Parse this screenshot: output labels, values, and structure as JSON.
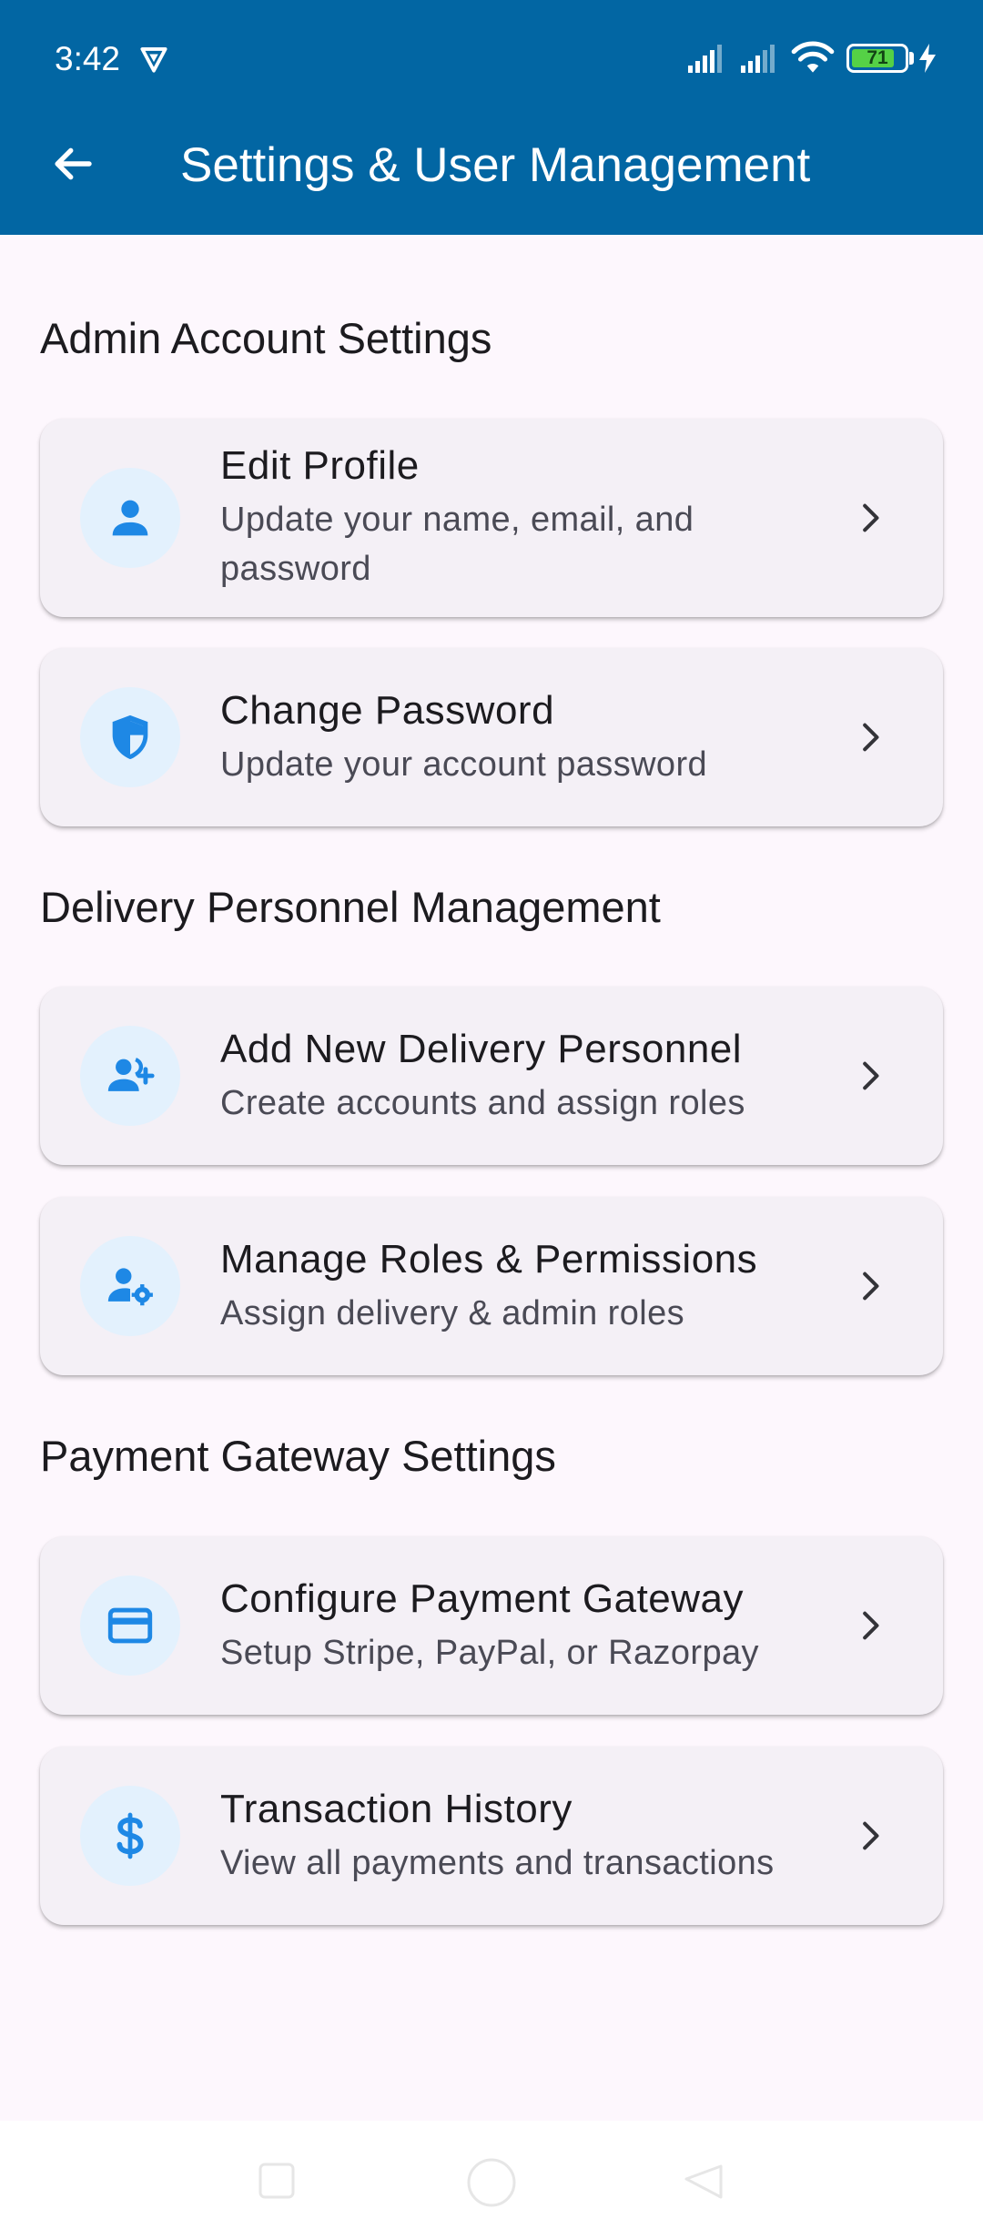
{
  "status_bar": {
    "time": "3:42",
    "battery_level": "71",
    "icons": [
      "vpn-shield-icon",
      "signal-icon",
      "signal-icon",
      "wifi-icon",
      "battery-icon",
      "charging-bolt-icon"
    ]
  },
  "app_bar": {
    "title": "Settings & User Management",
    "back_icon": "arrow-back-icon"
  },
  "sections": [
    {
      "title": "Admin Account Settings",
      "items": [
        {
          "title": "Edit Profile",
          "subtitle": "Update your name, email, and password",
          "icon": "person-icon"
        },
        {
          "title": "Change Password",
          "subtitle": "Update your account password",
          "icon": "shield-icon"
        }
      ]
    },
    {
      "title": "Delivery Personnel Management",
      "items": [
        {
          "title": "Add New Delivery Personnel",
          "subtitle": "Create accounts and assign roles",
          "icon": "person-add-icon"
        },
        {
          "title": "Manage Roles & Permissions",
          "subtitle": "Assign delivery & admin roles",
          "icon": "manage-accounts-icon"
        }
      ]
    },
    {
      "title": "Payment Gateway Settings",
      "items": [
        {
          "title": "Configure Payment Gateway",
          "subtitle": "Setup Stripe, PayPal, or Razorpay",
          "icon": "credit-card-icon"
        },
        {
          "title": "Transaction History",
          "subtitle": "View all payments and transactions",
          "icon": "dollar-icon"
        }
      ]
    }
  ],
  "colors": {
    "app_bar": "#0266a3",
    "icon_accent": "#1e88e5",
    "icon_circle": "#e3f1fd",
    "card_background": "#f4f0f6",
    "page_background": "#fdf7fd"
  }
}
